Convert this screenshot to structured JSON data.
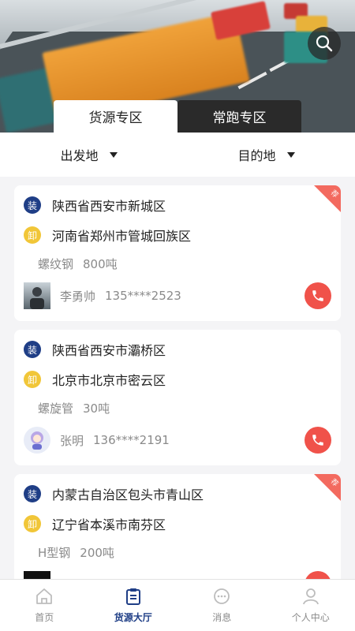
{
  "header": {
    "search_icon": "search-icon"
  },
  "tabs": [
    {
      "label": "货源专区",
      "active": true
    },
    {
      "label": "常跑专区",
      "active": false
    }
  ],
  "filters": {
    "origin": "出发地",
    "destination": "目的地"
  },
  "cards": [
    {
      "load_badge": "装",
      "load_addr": "陕西省西安市新城区",
      "unload_badge": "卸",
      "unload_addr": "河南省郑州市管城回族区",
      "goods_type": "螺纹钢",
      "goods_weight": "800吨",
      "contact_name": "李勇帅",
      "contact_phone": "135****2523",
      "corner_tag": "荐",
      "has_corner": true
    },
    {
      "load_badge": "装",
      "load_addr": "陕西省西安市灞桥区",
      "unload_badge": "卸",
      "unload_addr": "北京市北京市密云区",
      "goods_type": "螺旋管",
      "goods_weight": "30吨",
      "contact_name": "张明",
      "contact_phone": "136****2191",
      "has_corner": false
    },
    {
      "load_badge": "装",
      "load_addr": "内蒙古自治区包头市青山区",
      "unload_badge": "卸",
      "unload_addr": "辽宁省本溪市南芬区",
      "goods_type": "H型钢",
      "goods_weight": "200吨",
      "corner_tag": "荐",
      "has_corner": true
    }
  ],
  "nav": [
    {
      "label": "首页",
      "icon": "home-icon",
      "active": false
    },
    {
      "label": "货源大厅",
      "icon": "clipboard-icon",
      "active": true
    },
    {
      "label": "消息",
      "icon": "message-icon",
      "active": false
    },
    {
      "label": "个人中心",
      "icon": "user-icon",
      "active": false
    }
  ],
  "colors": {
    "primary": "#1f3e86",
    "unload": "#f1c638",
    "call": "#f0524a",
    "corner": "#f36a5f"
  }
}
